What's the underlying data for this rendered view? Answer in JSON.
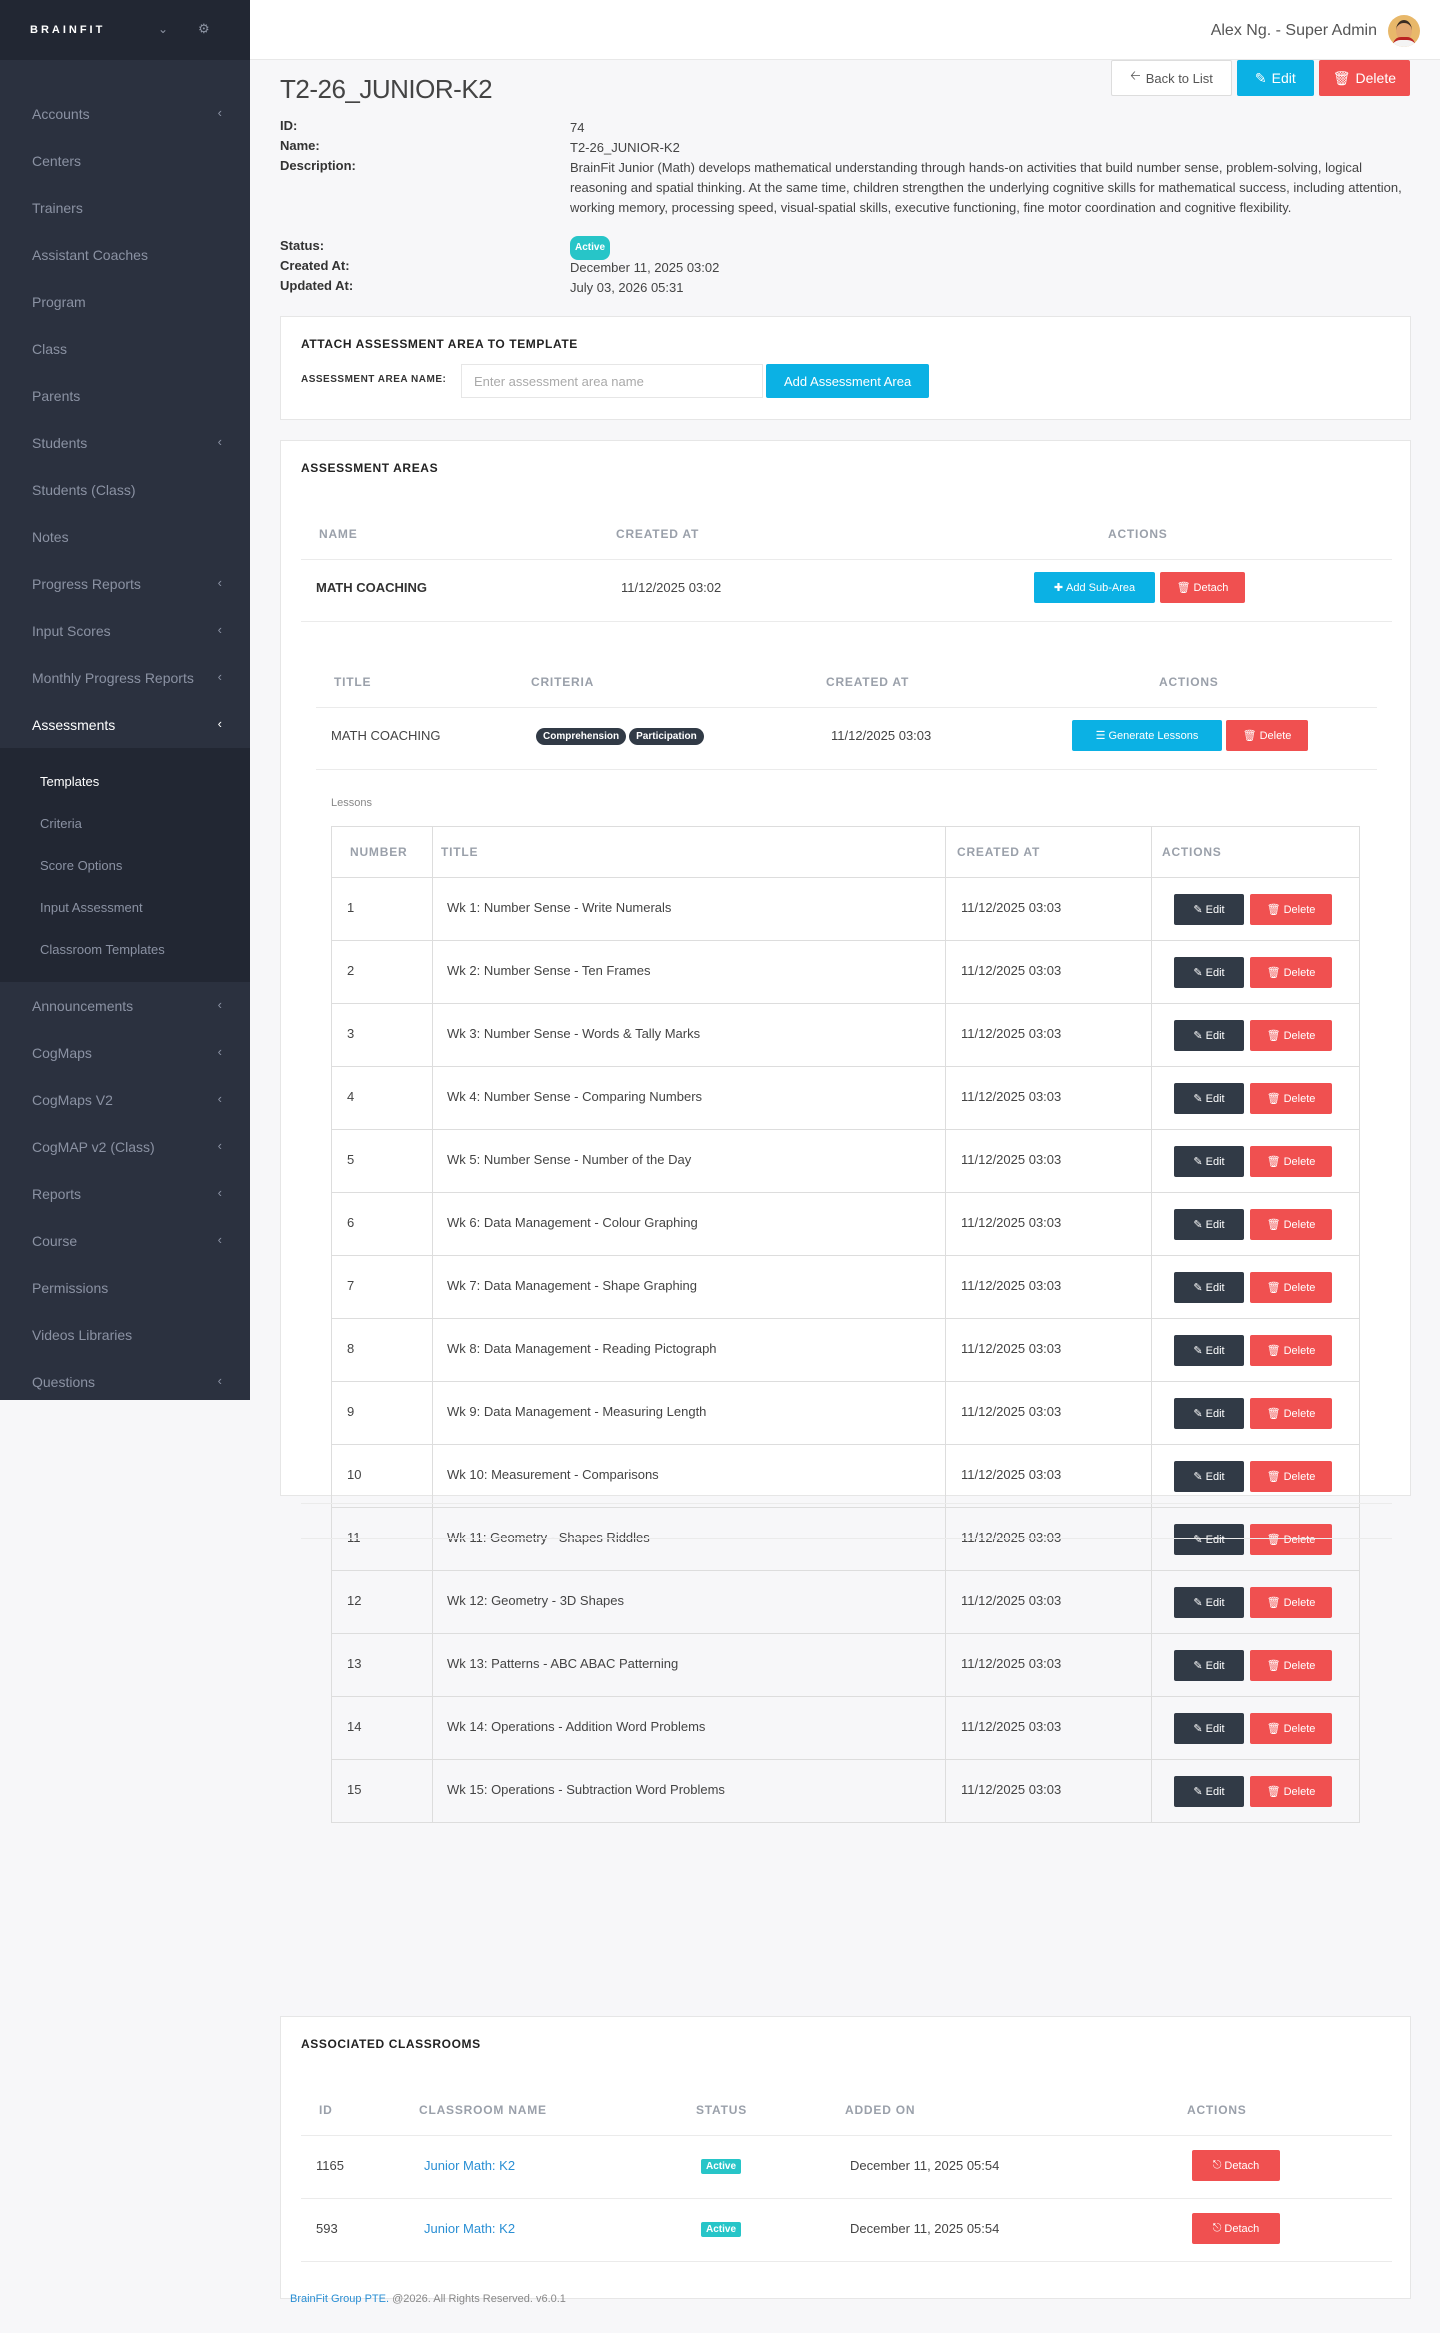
{
  "sidebar": {
    "brand": "BRAINFIT",
    "brand_chevron_icon": "chevron-down-icon",
    "brand_gear_icon": "gear-icon",
    "items": [
      {
        "label": "Accounts",
        "chevron": true
      },
      {
        "label": "Centers",
        "chevron": false
      },
      {
        "label": "Trainers",
        "chevron": false
      },
      {
        "label": "Assistant Coaches",
        "chevron": false
      },
      {
        "label": "Program",
        "chevron": false
      },
      {
        "label": "Class",
        "chevron": false
      },
      {
        "label": "Parents",
        "chevron": false
      },
      {
        "label": "Students",
        "chevron": true
      },
      {
        "label": "Students (Class)",
        "chevron": false
      },
      {
        "label": "Notes",
        "chevron": false
      },
      {
        "label": "Progress Reports",
        "chevron": true
      },
      {
        "label": "Input Scores",
        "chevron": true
      },
      {
        "label": "Monthly Progress Reports",
        "chevron": true
      },
      {
        "label": "Assessments",
        "chevron": true,
        "active": true
      }
    ],
    "submenu": [
      "Templates",
      "Criteria",
      "Score Options",
      "Input Assessment",
      "Classroom Templates"
    ],
    "items_after": [
      {
        "label": "Announcements",
        "chevron": true
      },
      {
        "label": "CogMaps",
        "chevron": true
      },
      {
        "label": "CogMaps V2",
        "chevron": true
      },
      {
        "label": "CogMAP v2 (Class)",
        "chevron": true
      },
      {
        "label": "Reports",
        "chevron": true
      },
      {
        "label": "Course",
        "chevron": true
      },
      {
        "label": "Permissions",
        "chevron": false
      },
      {
        "label": "Videos Libraries",
        "chevron": false
      },
      {
        "label": "Questions",
        "chevron": true
      }
    ]
  },
  "topbar": {
    "user": "Alex Ng. - Super Admin"
  },
  "header": {
    "title": "T2-26_JUNIOR-K2",
    "back_label": "Back to List",
    "edit_label": "Edit",
    "delete_label": "Delete"
  },
  "details": {
    "id_label": "ID:",
    "id": "74",
    "name_label": "Name:",
    "name": "T2-26_JUNIOR-K2",
    "description_label": "Description:",
    "description": "BrainFit Junior (Math) develops mathematical understanding through hands-on activities that build number sense, problem-solving, logical reasoning and spatial thinking. At the same time, children strengthen the underlying cognitive skills for mathematical success, including attention, working memory, processing speed, visual-spatial skills, executive functioning, fine motor coordination and cognitive flexibility.",
    "status_label": "Status:",
    "status": "Active",
    "created_label": "Created At:",
    "created": "December 11, 2025 03:02",
    "updated_label": "Updated At:",
    "updated": "July 03, 2026 05:31"
  },
  "attach": {
    "title": "ATTACH ASSESSMENT AREA TO TEMPLATE",
    "field_label": "ASSESSMENT AREA NAME:",
    "placeholder": "Enter assessment area name",
    "button": "Add Assessment Area"
  },
  "areas": {
    "title": "ASSESSMENT AREAS",
    "columns": [
      "NAME",
      "CREATED AT",
      "ACTIONS"
    ],
    "row": {
      "name": "MATH COACHING",
      "created": "11/12/2025 03:02",
      "add_sub": "Add Sub-Area",
      "detach": "Detach"
    },
    "sub_columns": [
      "TITLE",
      "CRITERIA",
      "CREATED AT",
      "ACTIONS"
    ],
    "sub_row": {
      "title": "MATH COACHING",
      "criteria": [
        "Comprehension",
        "Participation"
      ],
      "created": "11/12/2025 03:03",
      "generate": "Generate Lessons",
      "delete": "Delete"
    },
    "lessons_label": "Lessons",
    "lesson_columns": [
      "NUMBER",
      "TITLE",
      "CREATED AT",
      "ACTIONS"
    ],
    "lessons": [
      {
        "number": "1",
        "title": "Wk 1: Number Sense - Write Numerals",
        "created": "11/12/2025 03:03"
      },
      {
        "number": "2",
        "title": "Wk 2: Number Sense - Ten Frames",
        "created": "11/12/2025 03:03"
      },
      {
        "number": "3",
        "title": "Wk 3: Number Sense - Words & Tally Marks",
        "created": "11/12/2025 03:03"
      },
      {
        "number": "4",
        "title": "Wk 4: Number Sense - Comparing Numbers",
        "created": "11/12/2025 03:03"
      },
      {
        "number": "5",
        "title": "Wk 5: Number Sense - Number of the Day",
        "created": "11/12/2025 03:03"
      },
      {
        "number": "6",
        "title": "Wk 6: Data Management - Colour Graphing",
        "created": "11/12/2025 03:03"
      },
      {
        "number": "7",
        "title": "Wk 7: Data Management - Shape Graphing",
        "created": "11/12/2025 03:03"
      },
      {
        "number": "8",
        "title": "Wk 8: Data Management - Reading Pictograph",
        "created": "11/12/2025 03:03"
      },
      {
        "number": "9",
        "title": "Wk 9: Data Management - Measuring Length",
        "created": "11/12/2025 03:03"
      },
      {
        "number": "10",
        "title": "Wk 10: Measurement - Comparisons",
        "created": "11/12/2025 03:03"
      },
      {
        "number": "11",
        "title": "Wk 11: Geometry - Shapes Riddles",
        "created": "11/12/2025 03:03"
      },
      {
        "number": "12",
        "title": "Wk 12: Geometry - 3D Shapes",
        "created": "11/12/2025 03:03"
      },
      {
        "number": "13",
        "title": "Wk 13: Patterns - ABC ABAC Patterning",
        "created": "11/12/2025 03:03"
      },
      {
        "number": "14",
        "title": "Wk 14: Operations - Addition Word Problems",
        "created": "11/12/2025 03:03"
      },
      {
        "number": "15",
        "title": "Wk 15: Operations - Subtraction Word Problems",
        "created": "11/12/2025 03:03"
      }
    ],
    "edit_label": "Edit",
    "delete_label": "Delete"
  },
  "classrooms": {
    "title": "ASSOCIATED CLASSROOMS",
    "columns": [
      "ID",
      "CLASSROOM NAME",
      "STATUS",
      "ADDED ON",
      "ACTIONS"
    ],
    "rows": [
      {
        "id": "1165",
        "name": "Junior Math: K2",
        "status": "Active",
        "added": "December 11, 2025 05:54",
        "action": "Detach"
      },
      {
        "id": "593",
        "name": "Junior Math: K2",
        "status": "Active",
        "added": "December 11, 2025 05:54",
        "action": "Detach"
      }
    ]
  },
  "footer": {
    "company": "BrainFit Group PTE.",
    "text": "@2026. All Rights Reserved. v6.0.1"
  },
  "colors": {
    "sidebar": "#2b313f",
    "info": "#0bb1e4",
    "danger": "#f05050",
    "dark": "#313a46",
    "active_badge": "#27c5c8"
  }
}
